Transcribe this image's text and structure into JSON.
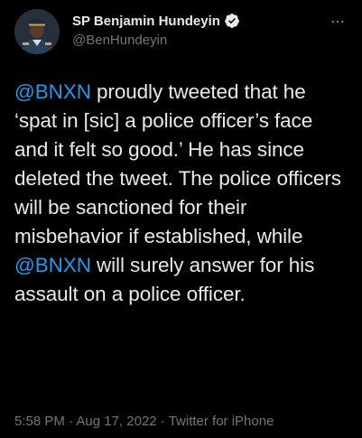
{
  "author": {
    "display_name": "SP Benjamin Hundeyin",
    "handle": "@BenHundeyin",
    "verified_icon": "verified-badge-icon",
    "avatar_icon": "profile-photo"
  },
  "more_icon": "more-options-icon",
  "tweet": {
    "seg1_mention": "@BNXN",
    "seg2_text": " proudly tweeted that he ‘spat in [sic] a police officer’s face and it felt so good.’ He has since deleted the tweet. The police officers will be sanctioned for their misbehavior if established, while ",
    "seg3_mention": "@BNXN",
    "seg4_text": " will surely answer for his assault on a police officer."
  },
  "meta": {
    "time": "5:58 PM",
    "sep1": " · ",
    "date": "Aug 17, 2022",
    "sep2": " · ",
    "source": "Twitter for iPhone"
  },
  "colors": {
    "background": "#000000",
    "text": "#e7e9ea",
    "secondary": "#71767b",
    "link": "#1d9bf0"
  }
}
